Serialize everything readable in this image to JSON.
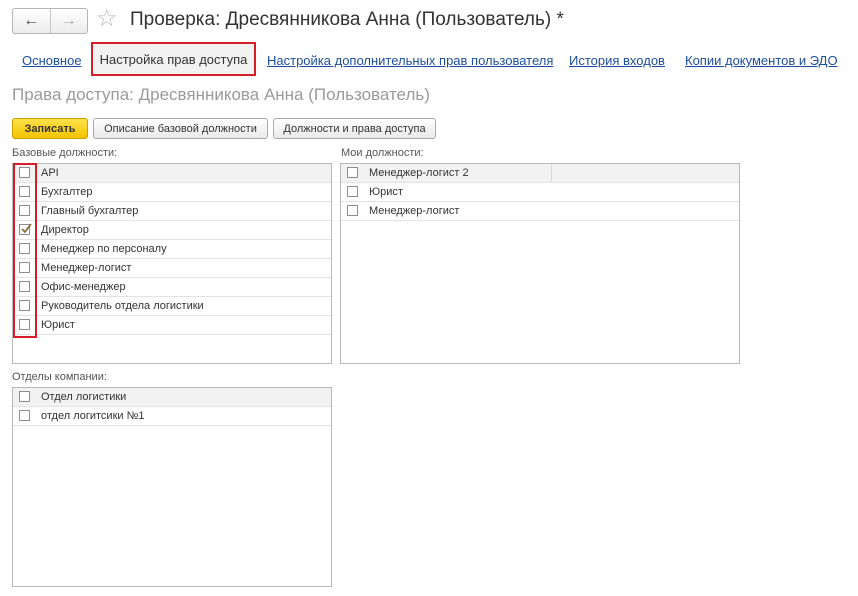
{
  "window": {
    "title": "Проверка: Дресвянникова Анна (Пользователь) *",
    "back_icon": "←",
    "forward_icon": "→",
    "star_icon": "☆"
  },
  "tabs": [
    {
      "label": "Основное"
    },
    {
      "label": "Настройка прав доступа"
    },
    {
      "label": "Настройка дополнительных прав пользователя"
    },
    {
      "label": "История входов"
    },
    {
      "label": "Копии документов и ЭДО"
    }
  ],
  "form": {
    "subtitle": "Права доступа: Дресвянникова Анна (Пользователь)"
  },
  "toolbar": {
    "save_label": "Записать",
    "base_position_label": "Описание базовой должности",
    "positions_rights_label": "Должности и права доступа"
  },
  "base_positions": {
    "label": "Базовые должности:",
    "items": [
      {
        "name": "API",
        "checked": false
      },
      {
        "name": "Бухгалтер",
        "checked": false
      },
      {
        "name": "Главный бухгалтер",
        "checked": false
      },
      {
        "name": "Директор",
        "checked": true
      },
      {
        "name": "Менеджер по персоналу",
        "checked": false
      },
      {
        "name": "Менеджер-логист",
        "checked": false
      },
      {
        "name": "Офис-менеджер",
        "checked": false
      },
      {
        "name": "Руководитель отдела логистики",
        "checked": false
      },
      {
        "name": "Юрист",
        "checked": false
      }
    ]
  },
  "my_positions": {
    "label": "Мои должности:",
    "items": [
      {
        "name": "Менеджер-логист 2",
        "checked": false
      },
      {
        "name": "Юрист",
        "checked": false
      },
      {
        "name": "Менеджер-логист",
        "checked": false
      }
    ]
  },
  "departments": {
    "label": "Отделы компании:",
    "items": [
      {
        "name": "Отдел логистики",
        "checked": false
      },
      {
        "name": "отдел логитсики №1",
        "checked": false
      }
    ]
  },
  "colors": {
    "accent_red": "#d41e2a",
    "primary_button": "#f3c400",
    "link": "#1f4fa0",
    "check": "#8b6d3a"
  }
}
